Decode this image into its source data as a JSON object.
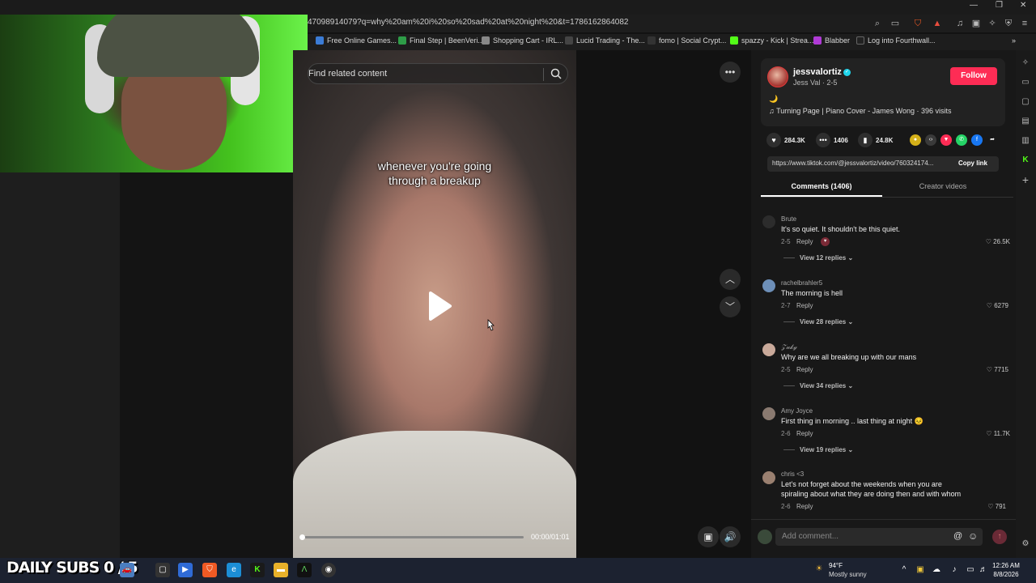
{
  "browser": {
    "url": "47098914079?q=why%20am%20i%20so%20sad%20at%20night%20&t=1786162864082",
    "bookmarks": [
      {
        "label": "Free Online Games...",
        "color": "#3b7cd6"
      },
      {
        "label": "Final Step | BeenVeri...",
        "color": "#2e9d48"
      },
      {
        "label": "Shopping Cart - IRL...",
        "color": "#888888"
      },
      {
        "label": "Lucid Trading - The...",
        "color": "#444444"
      },
      {
        "label": "fomo | Social Crypt...",
        "color": "#333333"
      },
      {
        "label": "spazzy - Kick | Strea...",
        "color": "#53fc18"
      },
      {
        "label": "Blabber",
        "color": "#b03ad6"
      },
      {
        "label": "Log into Fourthwall...",
        "color": "#222222"
      }
    ],
    "more_bookmarks": "»"
  },
  "search": {
    "placeholder": "Find related content"
  },
  "video": {
    "caption": "whenever you're going\nthrough a breakup",
    "progress": 0,
    "time": "00:00/01:01"
  },
  "profile": {
    "username": "jessvalortiz",
    "subname": "Jess Val · 2-5",
    "follow_label": "Follow",
    "description_emoji": "🌙",
    "music": "♫  Turning Page | Piano Cover - James Wong · 396 visits"
  },
  "stats": {
    "likes": "284.3K",
    "comments": "1406",
    "saves": "24.8K"
  },
  "share": {
    "link": "https://www.tiktok.com/@jessvalortiz/video/760324174...",
    "copy_label": "Copy link"
  },
  "tabs": {
    "comments": "Comments (1406)",
    "creator": "Creator videos"
  },
  "comments": [
    {
      "author": "Brute",
      "text": "It's so quiet. It shouldn't be this quiet.",
      "date": "2-5",
      "reply": "Reply",
      "likes": "26.5K",
      "view": "View 12 replies ⌄"
    },
    {
      "author": "rachelbrahler5",
      "text": "The morning is hell",
      "date": "2-7",
      "reply": "Reply",
      "likes": "6279",
      "view": "View 28 replies ⌄"
    },
    {
      "author": "𝒵𝓊𝓀𝓎",
      "text": "Why are we all breaking up with our mans",
      "date": "2-5",
      "reply": "Reply",
      "likes": "7715",
      "view": "View 34 replies ⌄"
    },
    {
      "author": "Amy Joyce",
      "text": "First thing in morning .. last thing at night 😣",
      "date": "2-6",
      "reply": "Reply",
      "likes": "11.7K",
      "view": "View 19 replies ⌄"
    },
    {
      "author": "chris <3",
      "text": "Let's not forget about the weekends when you are\nspiraling about what they are doing then and with whom",
      "date": "2-6",
      "reply": "Reply",
      "likes": "791",
      "view": ""
    }
  ],
  "comment_input": {
    "placeholder": "Add comment..."
  },
  "taskbar": {
    "subs_banner": "DAILY SUBS 0 / 5",
    "weather_temp": "94°F",
    "weather_desc": "Mostly sunny",
    "time": "12:26 AM",
    "date": "8/8/2026"
  },
  "colors": {
    "accent": "#fe2c55",
    "verified": "#20d5ec"
  }
}
